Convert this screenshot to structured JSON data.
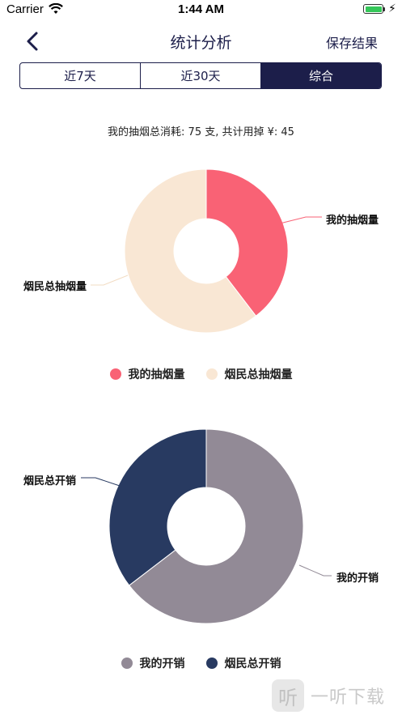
{
  "status_bar": {
    "carrier": "Carrier",
    "time": "1:44 AM"
  },
  "nav": {
    "title": "统计分析",
    "save_label": "保存结果"
  },
  "tabs": [
    {
      "label": "近7天",
      "active": false
    },
    {
      "label": "近30天",
      "active": false
    },
    {
      "label": "综合",
      "active": true
    }
  ],
  "summary_text": "我的抽烟总消耗: 75 支, 共计用掉 ¥: 45",
  "colors": {
    "primary": "#1c1e4a",
    "my_smoking": "#f96275",
    "total_smoking": "#f9e7d4",
    "my_spending": "#928a96",
    "total_spending": "#283a61",
    "label_line": "#999999"
  },
  "chart_data": [
    {
      "type": "pie",
      "variant": "donut",
      "slices": [
        {
          "label": "我的抽烟量",
          "value": 0.396,
          "color": "#f96275"
        },
        {
          "label": "烟民总抽烟量",
          "value": 0.604,
          "color": "#f9e7d4"
        }
      ],
      "legend": [
        "我的抽烟量",
        "烟民总抽烟量"
      ]
    },
    {
      "type": "pie",
      "variant": "donut",
      "slices": [
        {
          "label": "我的开销",
          "value": 0.646,
          "color": "#928a96"
        },
        {
          "label": "烟民总开销",
          "value": 0.354,
          "color": "#283a61"
        }
      ],
      "legend": [
        "我的开销",
        "烟民总开销"
      ]
    }
  ],
  "watermark": {
    "icon": "听",
    "text": "一听下载"
  }
}
